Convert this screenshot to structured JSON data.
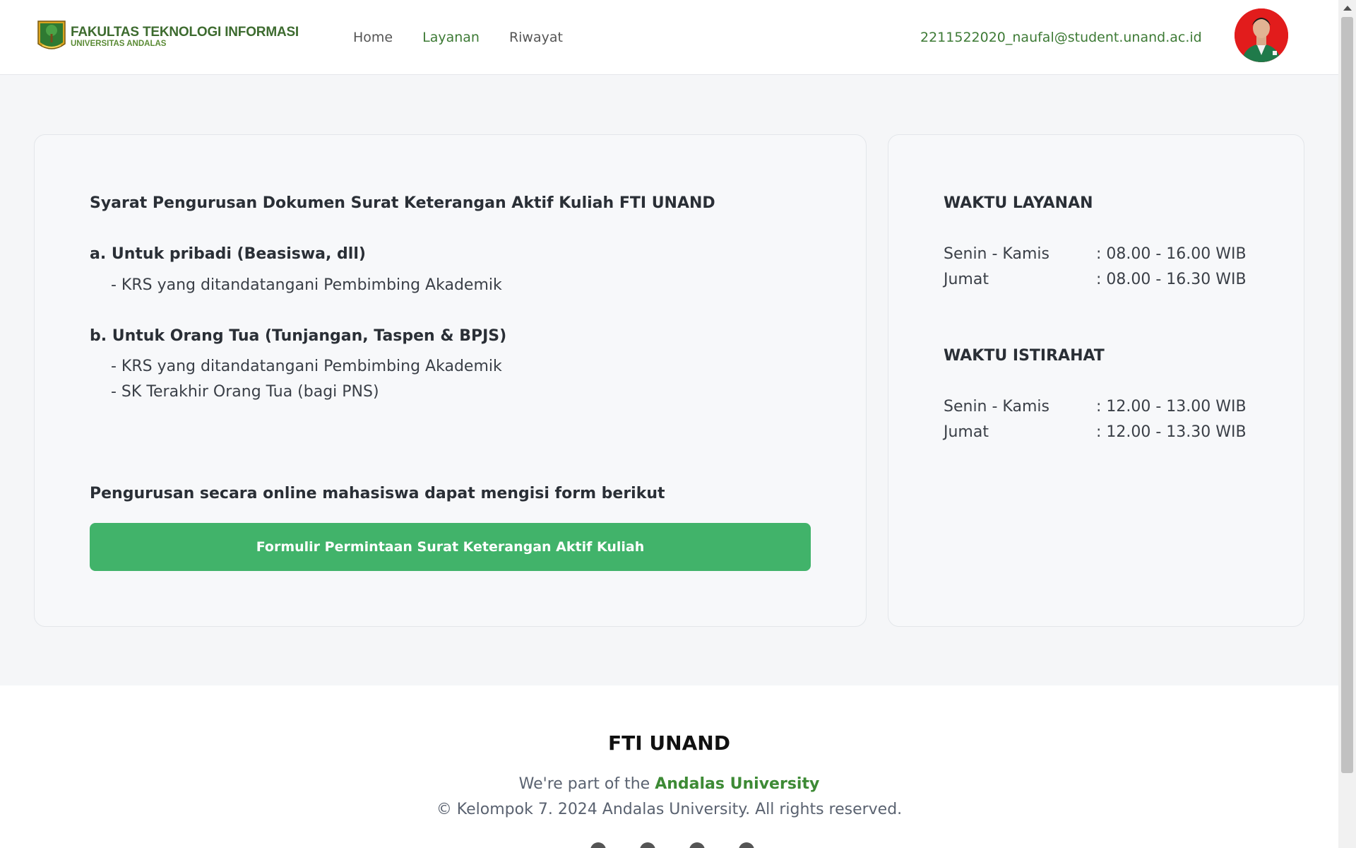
{
  "header": {
    "logo_title": "FAKULTAS TEKNOLOGI INFORMASI",
    "logo_sub": "UNIVERSITAS ANDALAS",
    "nav": [
      {
        "label": "Home",
        "active": false
      },
      {
        "label": "Layanan",
        "active": true
      },
      {
        "label": "Riwayat",
        "active": false
      }
    ],
    "user_email": "2211522020_naufal@student.unand.ac.id",
    "avatar_icon": "user-avatar"
  },
  "requirements": {
    "title": "Syarat Pengurusan Dokumen Surat Keterangan Aktif Kuliah FTI UNAND",
    "section_a": {
      "label": "a. Untuk pribadi (Beasiswa, dll)",
      "items": [
        "- KRS yang ditandatangani Pembimbing Akademik"
      ]
    },
    "section_b": {
      "label": "b. Untuk Orang Tua (Tunjangan, Taspen & BPJS)",
      "items": [
        "- KRS yang ditandatangani Pembimbing Akademik",
        "- SK Terakhir Orang Tua (bagi PNS)"
      ]
    },
    "online_text": "Pengurusan secara online mahasiswa dapat mengisi form berikut",
    "button_label": "Formulir Permintaan Surat Keterangan Aktif Kuliah"
  },
  "schedule": {
    "service_title": "WAKTU LAYANAN",
    "service": [
      {
        "day": "Senin - Kamis",
        "time": ": 08.00 - 16.00 WIB"
      },
      {
        "day": "Jumat",
        "time": ": 08.00 - 16.30 WIB"
      }
    ],
    "break_title": "WAKTU ISTIRAHAT",
    "break": [
      {
        "day": "Senin - Kamis",
        "time": ": 12.00 - 13.00 WIB"
      },
      {
        "day": "Jumat",
        "time": ": 12.00 - 13.30 WIB"
      }
    ]
  },
  "footer": {
    "title": "FTI UNAND",
    "part_prefix": "We're part of the ",
    "university": "Andalas University",
    "copyright": "© Kelompok 7. 2024 Andalas University. All rights reserved.",
    "social_icons": [
      "facebook-icon",
      "twitter-icon",
      "instagram-icon",
      "youtube-icon"
    ]
  },
  "colors": {
    "accent_green": "#3d7a35",
    "button_green": "#41b36a"
  }
}
